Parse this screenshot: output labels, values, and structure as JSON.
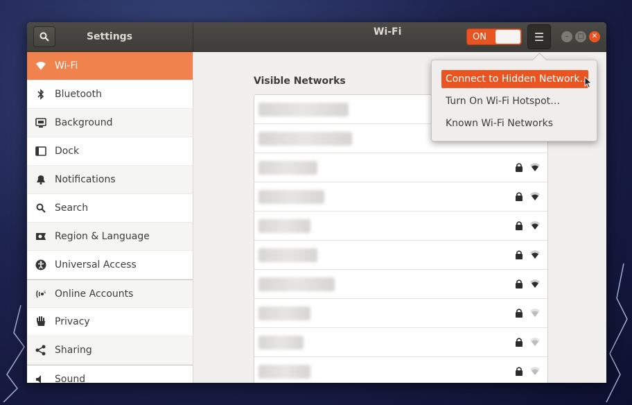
{
  "titlebar": {
    "settings_title": "Settings",
    "panel_title": "Wi-Fi",
    "wifi_switch": "ON"
  },
  "sidebar": {
    "items": [
      {
        "label": "Wi-Fi",
        "icon": "wifi-icon"
      },
      {
        "label": "Bluetooth",
        "icon": "bluetooth-icon"
      },
      {
        "label": "Background",
        "icon": "background-icon"
      },
      {
        "label": "Dock",
        "icon": "dock-icon"
      },
      {
        "label": "Notifications",
        "icon": "bell-icon"
      },
      {
        "label": "Search",
        "icon": "search-icon"
      },
      {
        "label": "Region & Language",
        "icon": "flag-icon"
      },
      {
        "label": "Universal Access",
        "icon": "accessibility-icon"
      },
      {
        "label": "Online Accounts",
        "icon": "online-accounts-icon"
      },
      {
        "label": "Privacy",
        "icon": "hand-icon"
      },
      {
        "label": "Sharing",
        "icon": "share-icon"
      },
      {
        "label": "Sound",
        "icon": "speaker-icon"
      }
    ]
  },
  "main": {
    "visible_networks_heading": "Visible Networks"
  },
  "menu": {
    "items": [
      "Connect to Hidden Network…",
      "Turn On Wi-Fi Hotspot…",
      "Known Wi-Fi Networks"
    ]
  },
  "colors": {
    "accent": "#e95420",
    "sidebar_active": "#f0824e"
  }
}
